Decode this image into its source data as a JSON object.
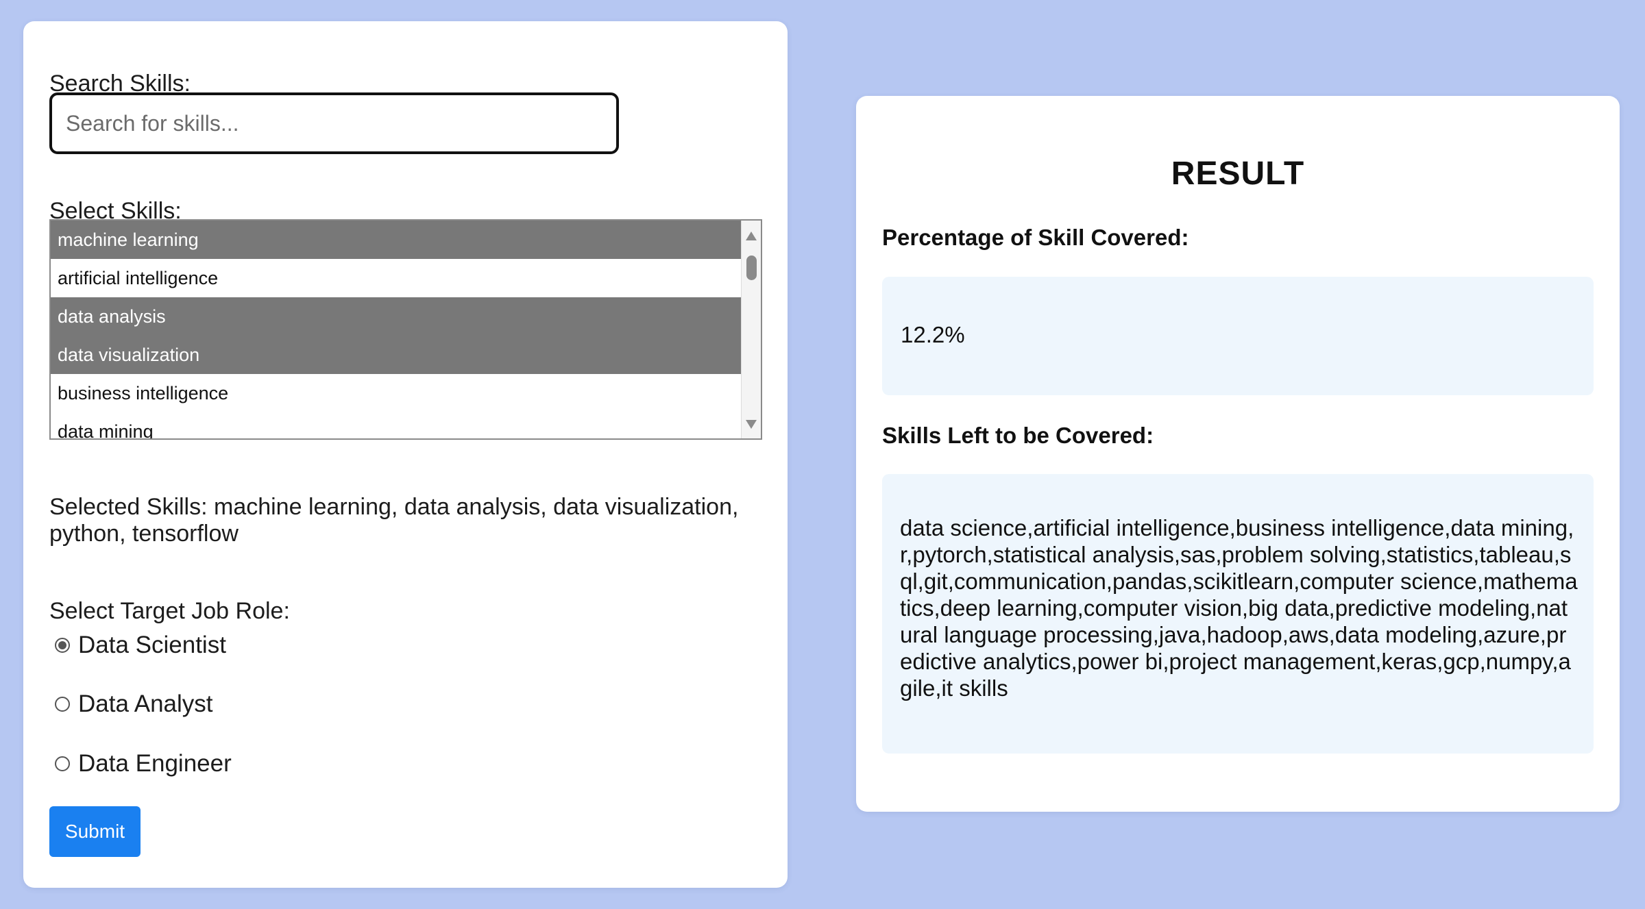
{
  "form": {
    "search_label": "Search Skills:",
    "search_placeholder": "Search for skills...",
    "select_label": "Select Skills:",
    "skills": [
      {
        "label": "machine learning",
        "selected": true
      },
      {
        "label": "artificial intelligence",
        "selected": false
      },
      {
        "label": "data analysis",
        "selected": true
      },
      {
        "label": "data visualization",
        "selected": true
      },
      {
        "label": "business intelligence",
        "selected": false
      },
      {
        "label": "data mining",
        "selected": false
      }
    ],
    "selected_skills_text": "Selected Skills: machine learning, data analysis, data visualization, python, tensorflow",
    "role_label": "Select Target Job Role:",
    "roles": [
      {
        "label": "Data Scientist",
        "checked": true
      },
      {
        "label": "Data Analyst",
        "checked": false
      },
      {
        "label": "Data Engineer",
        "checked": false
      }
    ],
    "submit_label": "Submit"
  },
  "result": {
    "title": "RESULT",
    "percentage_label": "Percentage of Skill Covered:",
    "percentage_value": "12.2%",
    "skills_left_label": "Skills Left to be Covered:",
    "skills_left_value": "data science,artificial intelligence,business intelligence,data mining,r,pytorch,statistical analysis,sas,problem solving,statistics,tableau,sql,git,communication,pandas,scikitlearn,computer science,mathematics,deep learning,computer vision,big data,predictive modeling,natural language processing,java,hadoop,aws,data modeling,azure,predictive analytics,power bi,project management,keras,gcp,numpy,agile,it skills"
  },
  "colors": {
    "background": "#b6c7f2",
    "selected_option": "#787878",
    "submit_button": "#1a80f0",
    "result_box": "#eef6fd"
  }
}
